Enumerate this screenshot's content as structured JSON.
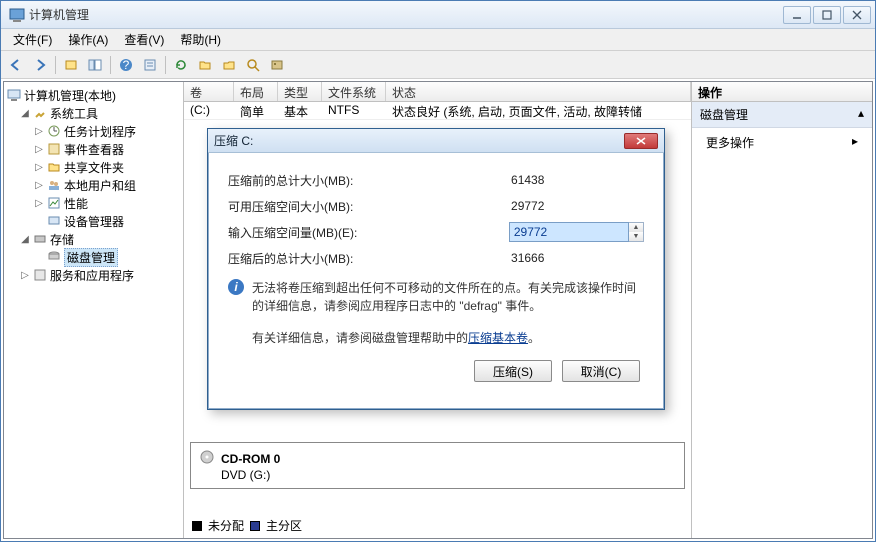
{
  "window": {
    "title": "计算机管理"
  },
  "menu": {
    "file": "文件(F)",
    "action": "操作(A)",
    "view": "查看(V)",
    "help": "帮助(H)"
  },
  "tree": {
    "root": "计算机管理(本地)",
    "sys": "系统工具",
    "tasks": "任务计划程序",
    "events": "事件查看器",
    "shared": "共享文件夹",
    "users": "本地用户和组",
    "perf": "性能",
    "devmgr": "设备管理器",
    "storage": "存储",
    "diskmgmt": "磁盘管理",
    "services": "服务和应用程序"
  },
  "list": {
    "cols": {
      "vol": "卷",
      "layout": "布局",
      "type": "类型",
      "fs": "文件系统",
      "status": "状态"
    },
    "row": {
      "vol": "(C:)",
      "layout": "简单",
      "type": "基本",
      "fs": "NTFS",
      "status": "状态良好 (系统, 启动, 页面文件, 活动, 故障转储"
    }
  },
  "disk": {
    "title": "CD-ROM 0",
    "sub": "DVD (G:)"
  },
  "legend": {
    "unalloc": "未分配",
    "primary": "主分区"
  },
  "actions": {
    "hdr": "操作",
    "diskmgmt": "磁盘管理",
    "more": "更多操作"
  },
  "dialog": {
    "title": "压缩 C:",
    "before": "压缩前的总计大小(MB):",
    "before_val": "61438",
    "avail": "可用压缩空间大小(MB):",
    "avail_val": "29772",
    "enter": "输入压缩空间量(MB)(E):",
    "enter_val": "29772",
    "after": "压缩后的总计大小(MB):",
    "after_val": "31666",
    "info": "无法将卷压缩到超出任何不可移动的文件所在的点。有关完成该操作时间的详细信息，请参阅应用程序日志中的 \"defrag\" 事件。",
    "helpline": "有关详细信息，请参阅磁盘管理帮助中的",
    "helplink": "压缩基本卷",
    "helptail": "。",
    "shrink": "压缩(S)",
    "cancel": "取消(C)"
  }
}
